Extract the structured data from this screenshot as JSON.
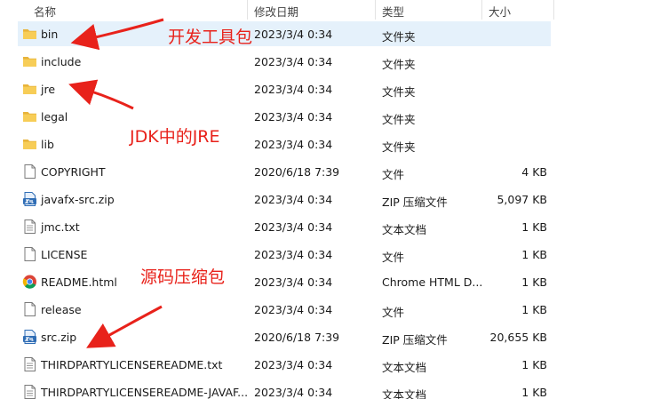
{
  "columns": {
    "name": "名称",
    "date": "修改日期",
    "type": "类型",
    "size": "大小"
  },
  "files": [
    {
      "name": "bin",
      "date": "2023/3/4 0:34",
      "type": "文件夹",
      "size": "",
      "icon": "folder-icon",
      "selected": true
    },
    {
      "name": "include",
      "date": "2023/3/4 0:34",
      "type": "文件夹",
      "size": "",
      "icon": "folder-icon"
    },
    {
      "name": "jre",
      "date": "2023/3/4 0:34",
      "type": "文件夹",
      "size": "",
      "icon": "folder-icon"
    },
    {
      "name": "legal",
      "date": "2023/3/4 0:34",
      "type": "文件夹",
      "size": "",
      "icon": "folder-icon"
    },
    {
      "name": "lib",
      "date": "2023/3/4 0:34",
      "type": "文件夹",
      "size": "",
      "icon": "folder-icon"
    },
    {
      "name": "COPYRIGHT",
      "date": "2020/6/18 7:39",
      "type": "文件",
      "size": "4 KB",
      "icon": "file-icon"
    },
    {
      "name": "javafx-src.zip",
      "date": "2023/3/4 0:34",
      "type": "ZIP 压缩文件",
      "size": "5,097 KB",
      "icon": "zip-icon"
    },
    {
      "name": "jmc.txt",
      "date": "2023/3/4 0:34",
      "type": "文本文档",
      "size": "1 KB",
      "icon": "text-file-icon"
    },
    {
      "name": "LICENSE",
      "date": "2023/3/4 0:34",
      "type": "文件",
      "size": "1 KB",
      "icon": "file-icon"
    },
    {
      "name": "README.html",
      "date": "2023/3/4 0:34",
      "type": "Chrome HTML D...",
      "size": "1 KB",
      "icon": "chrome-icon"
    },
    {
      "name": "release",
      "date": "2023/3/4 0:34",
      "type": "文件",
      "size": "1 KB",
      "icon": "file-icon"
    },
    {
      "name": "src.zip",
      "date": "2020/6/18 7:39",
      "type": "ZIP 压缩文件",
      "size": "20,655 KB",
      "icon": "zip-icon"
    },
    {
      "name": "THIRDPARTYLICENSEREADME.txt",
      "date": "2023/3/4 0:34",
      "type": "文本文档",
      "size": "1 KB",
      "icon": "text-file-icon"
    },
    {
      "name": "THIRDPARTYLICENSEREADME-JAVAF...",
      "date": "2023/3/4 0:34",
      "type": "文本文档",
      "size": "1 KB",
      "icon": "text-file-icon"
    }
  ],
  "annotations": {
    "dev_tools": "开发工具包",
    "jdk_jre": "JDK中的JRE",
    "source_zip": "源码压缩包"
  },
  "colors": {
    "annotation": "#e8221b",
    "selection": "#e5f1fb",
    "folder": "#f4c242"
  }
}
